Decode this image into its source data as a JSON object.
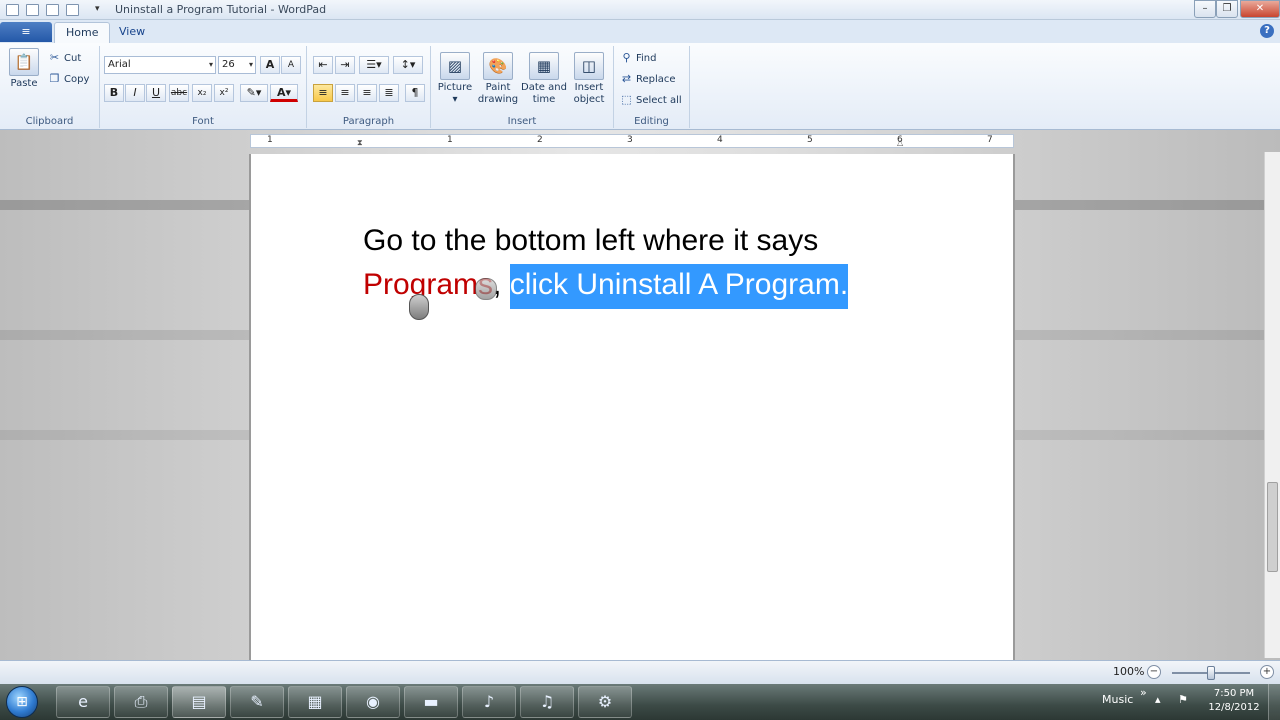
{
  "window": {
    "title": "Uninstall a Program Tutorial - WordPad",
    "buttons": {
      "minimize": "–",
      "maximize": "❐",
      "close": "✕"
    }
  },
  "tabs": [
    {
      "label": "Home",
      "active": true
    },
    {
      "label": "View",
      "active": false
    }
  ],
  "app_menu_icon": "≡",
  "help_icon": "?",
  "ribbon": {
    "clipboard": {
      "label": "Clipboard",
      "paste": "Paste",
      "cut": "Cut",
      "copy": "Copy"
    },
    "font": {
      "label": "Font",
      "family": "Arial",
      "size": "26",
      "grow": "A",
      "shrink": "A",
      "bold": "B",
      "italic": "I",
      "underline": "U",
      "strikethrough": "abc",
      "subscript": "x₂",
      "superscript": "x²",
      "highlight_icon": "✎",
      "color_icon": "A"
    },
    "paragraph": {
      "label": "Paragraph",
      "alignment": "left"
    },
    "insert": {
      "label": "Insert",
      "picture": "Picture",
      "paint_drawing": [
        "Paint",
        "drawing"
      ],
      "date_time": [
        "Date and",
        "time"
      ],
      "insert_object": [
        "Insert",
        "object"
      ]
    },
    "editing": {
      "label": "Editing",
      "find": "Find",
      "replace": "Replace",
      "select_all": "Select all"
    }
  },
  "ruler": {
    "numbers": [
      "1",
      "1",
      "2",
      "3",
      "4",
      "5",
      "6",
      "7"
    ]
  },
  "document": {
    "line1": "Go to the bottom left where it says",
    "line2_red": "Programs",
    "line2_comma": ", ",
    "line2_selected": "click Uninstall A Program.",
    "colors": {
      "red": "#c00000",
      "selection": "#3399ff"
    }
  },
  "statusbar": {
    "zoom": "100%",
    "zoom_level": 1.0
  },
  "taskbar": {
    "items": [
      {
        "name": "internet-explorer-icon",
        "glyph": "e"
      },
      {
        "name": "printer-icon",
        "glyph": "⎙"
      },
      {
        "name": "wordpad-icon",
        "glyph": "▤",
        "active": true
      },
      {
        "name": "paint-icon",
        "glyph": "✎"
      },
      {
        "name": "movie-maker-icon",
        "glyph": "▦"
      },
      {
        "name": "media-icon",
        "glyph": "◉"
      },
      {
        "name": "folder-icon",
        "glyph": "▬"
      },
      {
        "name": "mp3-converter-icon",
        "glyph": "♪"
      },
      {
        "name": "itunes-icon",
        "glyph": "♫"
      },
      {
        "name": "control-panel-icon",
        "glyph": "⚙"
      }
    ],
    "tray_label": "Music",
    "tray_chevron": "»",
    "time": "7:50 PM",
    "date": "12/8/2012"
  }
}
